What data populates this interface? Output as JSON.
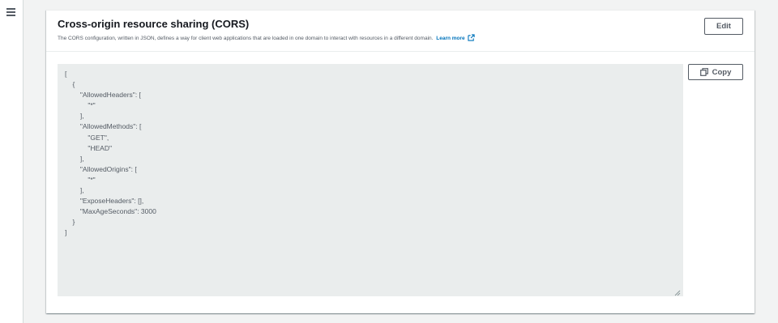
{
  "nav": {
    "menu_icon": "hamburger-menu-icon"
  },
  "panel": {
    "title": "Cross-origin resource sharing (CORS)",
    "description": "The CORS configuration, written in JSON, defines a way for client web applications that are loaded in one domain to interact with resources in a different domain.",
    "learn_more_label": "Learn more",
    "learn_more_icon": "external-link-icon",
    "edit_label": "Edit",
    "copy_label": "Copy",
    "copy_icon": "copy-icon"
  },
  "code": {
    "text": "[\n    {\n        \"AllowedHeaders\": [\n            \"*\"\n        ],\n        \"AllowedMethods\": [\n            \"GET\",\n            \"HEAD\"\n        ],\n        \"AllowedOrigins\": [\n            \"*\"\n        ],\n        \"ExposeHeaders\": [],\n        \"MaxAgeSeconds\": 3000\n    }\n]"
  },
  "colors": {
    "link": "#0073bb",
    "code_background": "#eaeded",
    "page_background": "#f2f3f3"
  }
}
